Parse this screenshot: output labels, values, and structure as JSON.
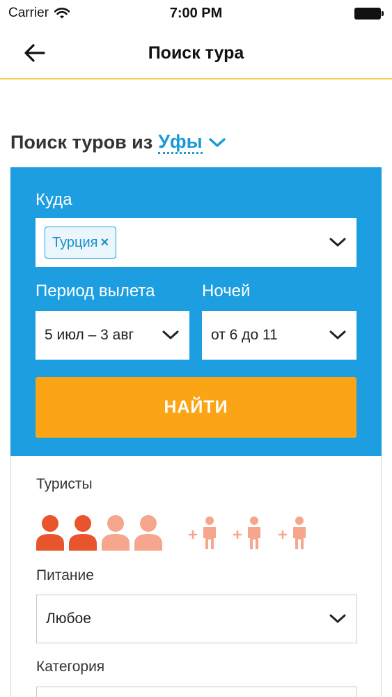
{
  "status_bar": {
    "carrier": "Carrier",
    "time": "7:00 PM"
  },
  "nav": {
    "title": "Поиск тура"
  },
  "heading": {
    "prefix": "Поиск туров из",
    "city": "Уфы"
  },
  "search_form": {
    "destination_label": "Куда",
    "destination_tags": [
      "Турция"
    ],
    "tag_remove_glyph": "×",
    "period_label": "Период вылета",
    "period_value": "5 июл – 3 авг",
    "nights_label": "Ночей",
    "nights_value": "от 6 до 11",
    "find_button": "НАЙТИ"
  },
  "options": {
    "tourists_label": "Туристы",
    "adults_total": 4,
    "adults_selected": 2,
    "children_slots": 3,
    "meal_label": "Питание",
    "meal_value": "Любое",
    "category_label": "Категория"
  },
  "colors": {
    "accent_blue": "#1c9ee0",
    "find_orange": "#fba415",
    "adult_selected": "#e8542c",
    "adult_unselected": "#f5a68c",
    "child_icon": "#f5a68c",
    "divider_yellow": "#f2d04a"
  },
  "icons": {
    "wifi": "wifi-icon",
    "battery": "battery-icon",
    "back": "arrow-left-icon",
    "chevron": "chevron-down-icon",
    "adult": "person-icon",
    "child": "child-add-icon"
  }
}
